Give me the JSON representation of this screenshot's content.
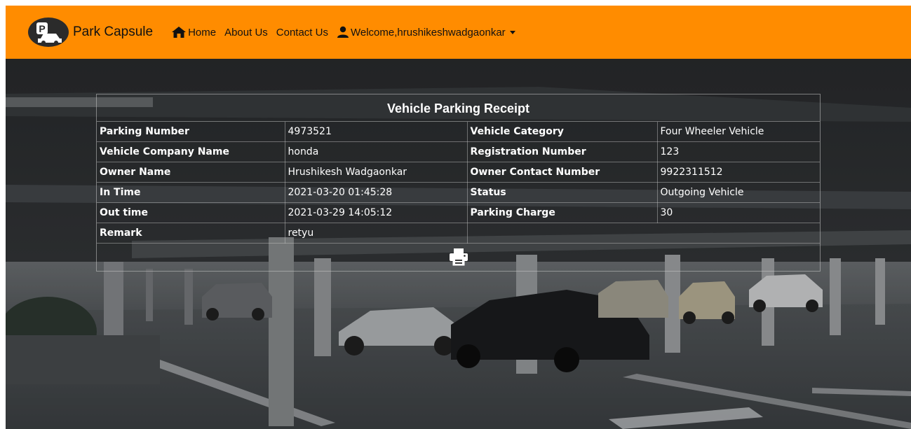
{
  "navbar": {
    "brand_name": "Park Capsule",
    "brand_logo_letter": "P",
    "home_label": "Home",
    "about_label": "About Us",
    "contact_label": "Contact Us",
    "user_label": "Welcome,hrushikeshwadgaonkar",
    "accent_color": "#ff8c00"
  },
  "receipt": {
    "title": "Vehicle Parking Receipt",
    "rows": [
      {
        "l1": "Parking Number",
        "v1": "4973521",
        "l2": "Vehicle Category",
        "v2": "Four Wheeler Vehicle"
      },
      {
        "l1": "Vehicle Company Name",
        "v1": "honda",
        "l2": "Registration Number",
        "v2": "123"
      },
      {
        "l1": "Owner Name",
        "v1": "Hrushikesh Wadgaonkar",
        "l2": "Owner Contact Number",
        "v2": "9922311512"
      },
      {
        "l1": "In Time",
        "v1": "2021-03-20 01:45:28",
        "l2": "Status",
        "v2": "Outgoing Vehicle"
      },
      {
        "l1": "Out time",
        "v1": "2021-03-29 14:05:12",
        "l2": "Parking Charge",
        "v2": "30"
      },
      {
        "l1": "Remark",
        "v1": "retyu"
      }
    ],
    "print_icon": "print-icon"
  }
}
